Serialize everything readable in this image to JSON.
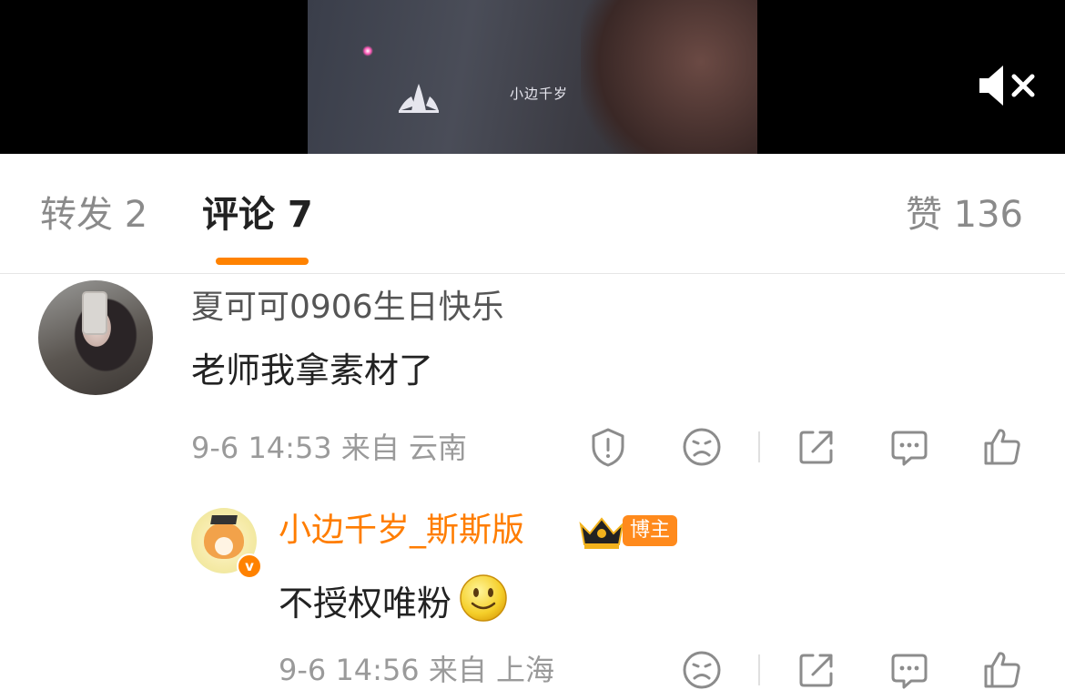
{
  "video": {
    "watermark": "小边千岁",
    "mute_icon": "speaker-muted-icon"
  },
  "tabs": {
    "repost_label": "转发 2",
    "comments_label": "评论 7",
    "likes_label": "赞 136",
    "active": "comments",
    "accent_color": "#ff8200"
  },
  "comments": [
    {
      "username": "夏可可0906生日快乐",
      "text": "老师我拿素材了",
      "time_location": "9-6 14:53 来自 云南",
      "actions": [
        "report-icon",
        "frown-icon",
        "share-icon",
        "reply-icon",
        "like-icon"
      ]
    }
  ],
  "replies": [
    {
      "username": "小边千岁_斯斯版",
      "badge": "博主",
      "verified": "v",
      "text": "不授权唯粉",
      "emoji": "smile-emoji-icon",
      "time_location": "9-6 14:56 来自 上海",
      "actions": [
        "frown-icon",
        "share-icon",
        "reply-icon",
        "like-icon"
      ]
    }
  ]
}
